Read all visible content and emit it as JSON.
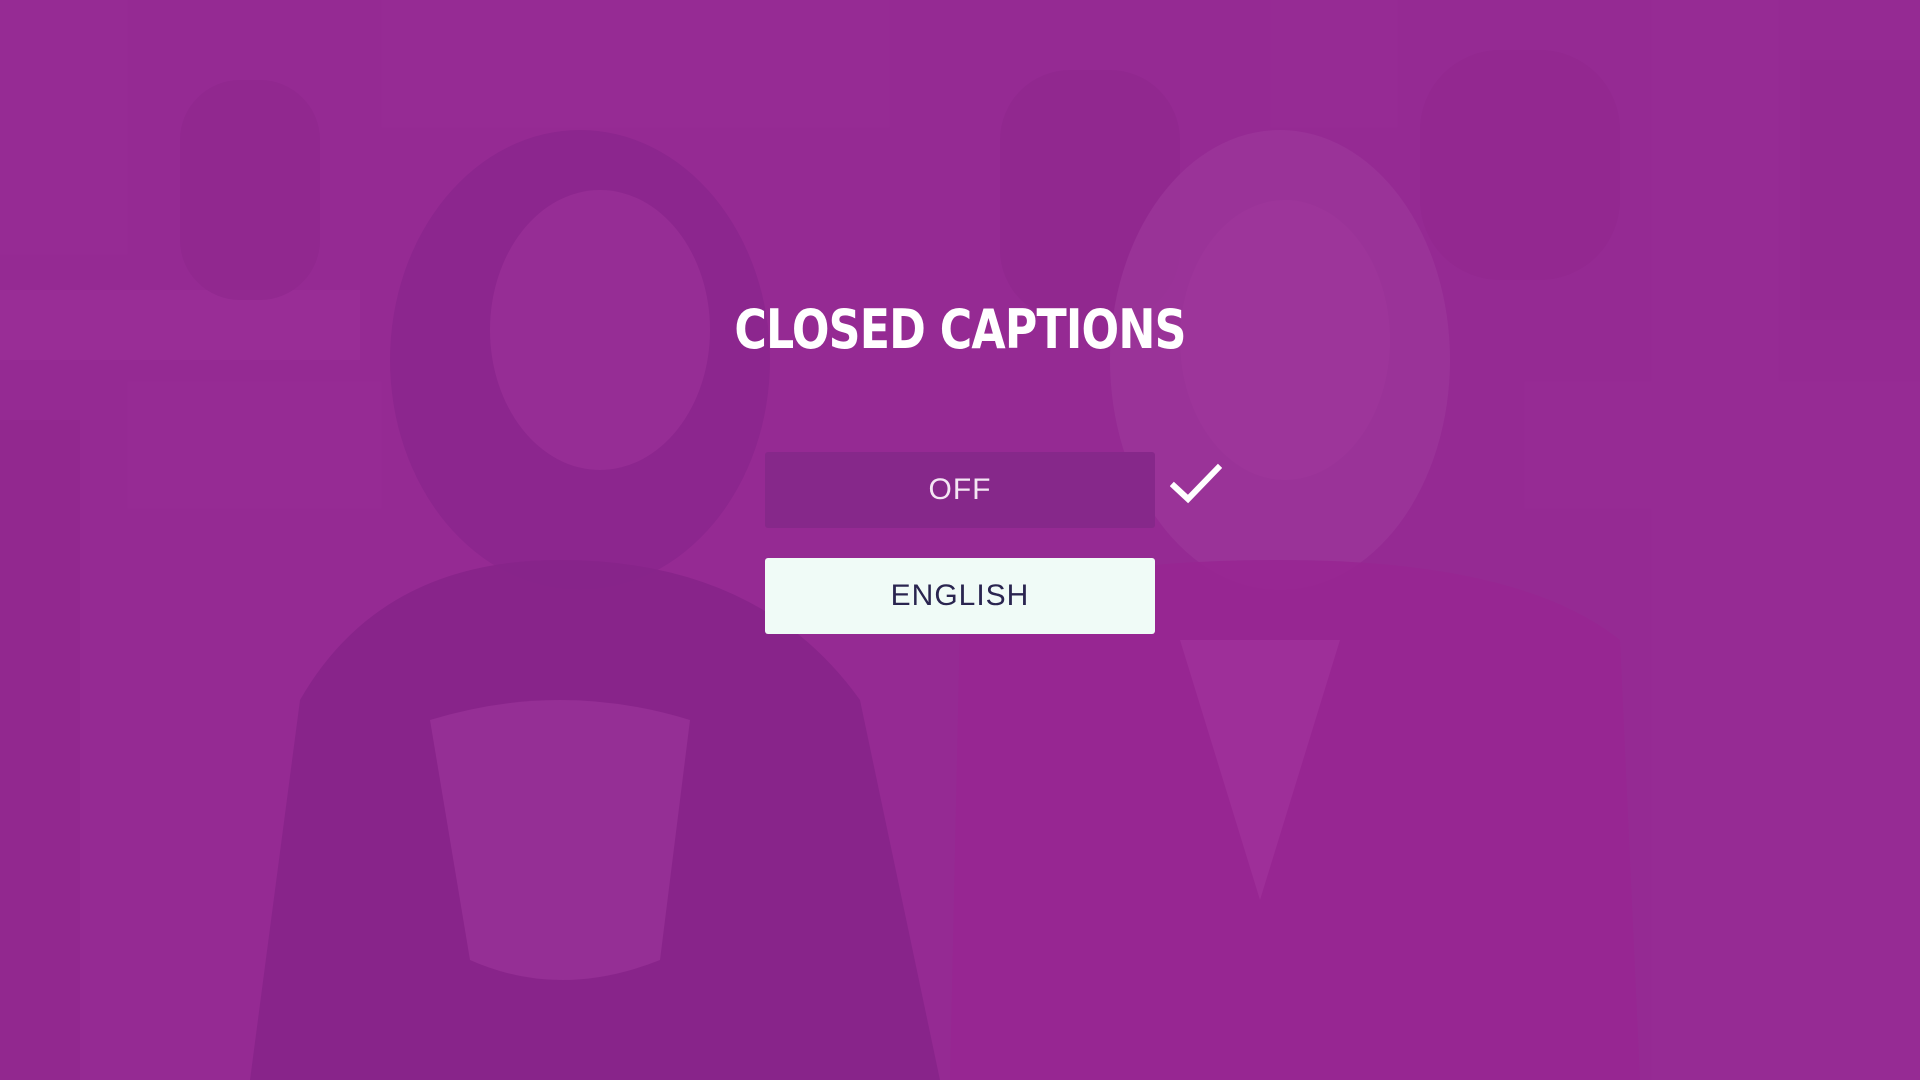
{
  "dialog": {
    "title": "CLOSED CAPTIONS",
    "options": [
      {
        "label": "OFF",
        "selected": true
      },
      {
        "label": "ENGLISH",
        "selected": false,
        "focused": true
      }
    ],
    "selected_indicator_icon": "checkmark-icon"
  },
  "colors": {
    "overlay_tint": "#93298f",
    "selected_option_bg": "#86288a",
    "focused_option_bg": "#f0fbf7",
    "focused_option_text": "#2a2550",
    "title_text": "#ffffff"
  }
}
